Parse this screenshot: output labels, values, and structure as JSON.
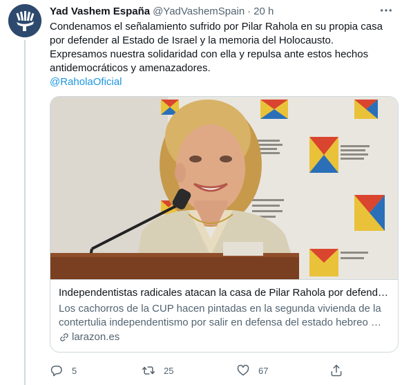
{
  "tweet": {
    "display_name": "Yad Vashem España",
    "handle": "@YadVashemSpain",
    "separator": "·",
    "time": "20 h",
    "text_lines": [
      "Condenamos el señalamiento sufrido por Pilar Rahola en su propia casa por defender al Estado de Israel y la memoria del Holocausto.",
      "Expresamos nuestra solidaridad con ella y repulsa ante estos hechos antidemocráticos y amenazadores."
    ],
    "mention": "@RaholaOficial"
  },
  "card": {
    "title": "Independentistas radicales atacan la casa de Pilar Rahola por defender …",
    "description": "Los cachorros de la CUP hacen pintadas en la segunda vivienda de la contertulia independentismo por salir en defensa del estado hebreo …",
    "domain": "larazon.es"
  },
  "actions": {
    "reply_count": "5",
    "retweet_count": "25",
    "like_count": "67"
  },
  "icons": {
    "avatar": "yad-vashem-logo",
    "more": "more-icon",
    "link": "link-icon",
    "reply": "reply-icon",
    "retweet": "retweet-icon",
    "like": "heart-icon",
    "share": "share-icon"
  },
  "colors": {
    "link": "#1b95e0",
    "secondary_text": "#536471",
    "border": "#cfd9de"
  }
}
